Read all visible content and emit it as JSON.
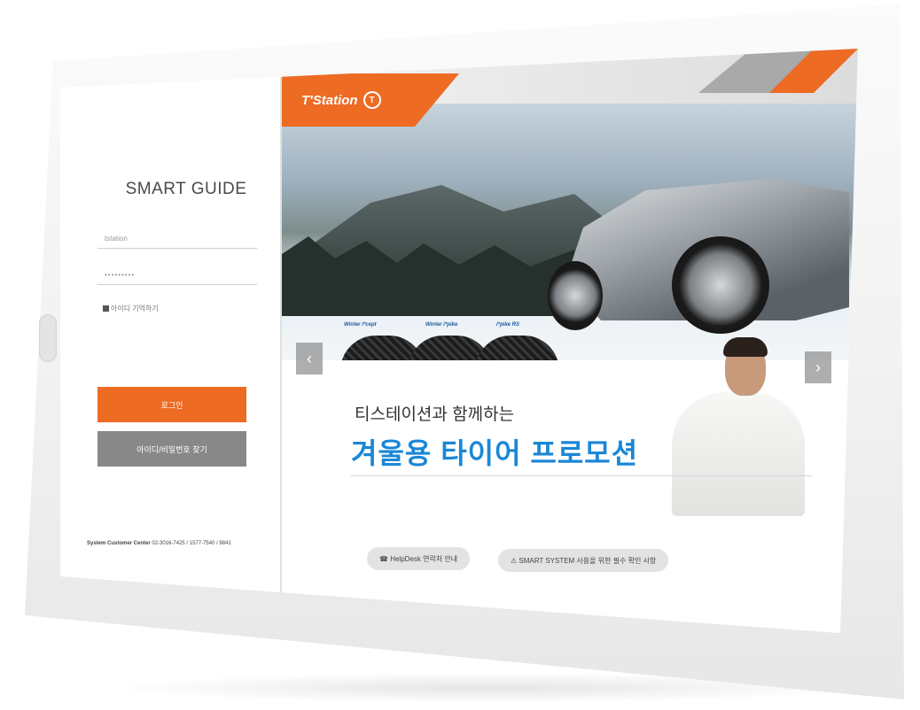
{
  "login": {
    "title": "SMART GUIDE",
    "id_placeholder": "tstation",
    "pw_value": "•••••••••",
    "remember_label": "아이디 기억하기",
    "login_button": "로그인",
    "find_button": "아이디/비밀번호 찾기",
    "contact_label": "System Customer Center",
    "contact_numbers": "02-3016-7425 / 1577-7540 / 9841"
  },
  "promo": {
    "brand": "T'Station",
    "brand_mark": "T",
    "tire_labels": [
      "Winter i*cept",
      "Winter i*pike",
      "i*pike RS"
    ],
    "subtitle": "티스테이션과 함께하는",
    "headline": "겨울용 타이어 프로모션",
    "prev_label": "‹",
    "next_label": "›",
    "links": {
      "helpdesk": "☎ HelpDesk 연락처 안내",
      "notice": "⚠ SMART SYSTEM 사용을 위한 필수 확인 사항"
    }
  },
  "colors": {
    "accent": "#ee6b23",
    "headline_blue": "#1a87d6",
    "button_gray": "#888888"
  },
  "icons": [
    "logo-t-icon",
    "checkbox-icon",
    "phone-icon",
    "warning-icon",
    "chevron-left-icon",
    "chevron-right-icon"
  ]
}
